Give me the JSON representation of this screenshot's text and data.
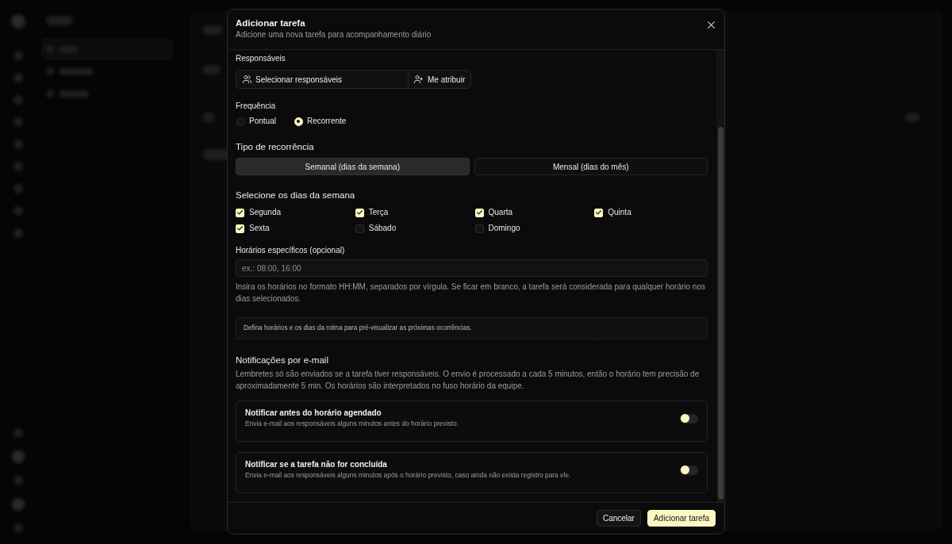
{
  "dialog": {
    "title": "Adicionar tarefa",
    "subtitle": "Adicione uma nova tarefa para acompanhamento diário"
  },
  "assignees": {
    "label": "Responsáveis",
    "select_button": "Selecionar responsáveis",
    "assign_me_button": "Me atribuir"
  },
  "frequency": {
    "label": "Frequência",
    "options": [
      {
        "label": "Pontual",
        "selected": false
      },
      {
        "label": "Recorrente",
        "selected": true
      }
    ]
  },
  "recurrence_type": {
    "heading": "Tipo de recorrência",
    "options": [
      {
        "label": "Semanal (dias da semana)",
        "selected": true
      },
      {
        "label": "Mensal (dias do mês)",
        "selected": false
      }
    ]
  },
  "weekdays": {
    "heading": "Selecione os dias da semana",
    "days": [
      {
        "label": "Segunda",
        "checked": true
      },
      {
        "label": "Terça",
        "checked": true
      },
      {
        "label": "Quarta",
        "checked": true
      },
      {
        "label": "Quinta",
        "checked": true
      },
      {
        "label": "Sexta",
        "checked": true
      },
      {
        "label": "Sábado",
        "checked": false
      },
      {
        "label": "Domingo",
        "checked": false
      }
    ]
  },
  "times": {
    "label": "Horários específicos (opcional)",
    "placeholder": "ex.: 08:00, 16:00",
    "help": "Insira os horários no formato HH:MM, separados por vírgula. Se ficar em branco, a tarefa será considerada para qualquer horário nos dias selecionados.",
    "preview_note": "Defina horários e os dias da rotina para pré-visualizar as próximas ocorrências."
  },
  "notifications": {
    "heading": "Notificações por e-mail",
    "description": "Lembretes só são enviados se a tarefa tiver responsáveis. O envio é processado a cada 5 minutos, então o horário tem precisão de aproximadamente 5 min. Os horários são interpretados no fuso horário da equipe.",
    "options": [
      {
        "title": "Notificar antes do horário agendado",
        "description": "Envia e-mail aos responsáveis alguns minutos antes do horário previsto.",
        "on": false
      },
      {
        "title": "Notificar se a tarefa não for concluída",
        "description": "Envia e-mail aos responsáveis alguns minutos após o horário previsto, caso ainda não exista registro para ele.",
        "on": false
      }
    ]
  },
  "footer": {
    "buttons": [
      {
        "label": "Cancelar",
        "kind": "secondary"
      },
      {
        "label": "Adicionar tarefa",
        "kind": "primary"
      }
    ]
  }
}
